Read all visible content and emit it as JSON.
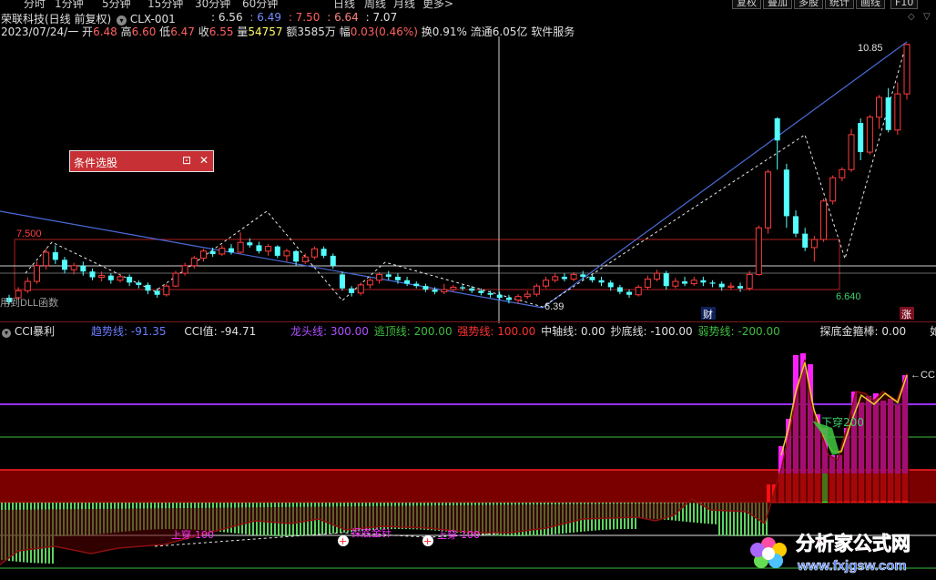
{
  "period_bar": {
    "items": [
      "分时",
      "1分钟",
      "5分钟",
      "15分钟",
      "30分钟",
      "60分钟",
      "日线",
      "周线",
      "月线",
      "更多>"
    ],
    "buttons": [
      "复权",
      "叠加",
      "多股",
      "统计",
      "画线",
      "F10"
    ]
  },
  "header": {
    "stock_name": "荣联科技(日线 前复权)",
    "indicator_name": "CLX-001",
    "ind_v1": ": 6.56",
    "ind_v2": ": 6.49",
    "ind_v3": ": 7.50",
    "ind_v4": ": 6.64",
    "ind_v5": ": 7.07",
    "date": "2023/07/24/一",
    "open_label": "开",
    "open": "6.48",
    "high_label": "高",
    "high": "6.60",
    "low_label": "低",
    "low": "6.47",
    "close_label": "收",
    "close": "6.55",
    "vol_label": "量",
    "vol": "54757",
    "amount": "额3585万",
    "change_label": "幅",
    "change": "0.03(0.46%)",
    "turnover": "换0.91%",
    "float": "流通6.05亿",
    "sector": "软件服务"
  },
  "main_chart": {
    "level_high": "7.500",
    "level_low": "6.640",
    "peak_label": "10.85",
    "trough_label": "6.39",
    "dll_text": "用到DLL函数",
    "cai_badge": "财",
    "zhang_badge": "涨"
  },
  "panel": {
    "title": "条件选股",
    "restore": "⊡",
    "close": "✕"
  },
  "sub_header": {
    "name": "CCI暴利",
    "trend_label": "趋势线: -91.35",
    "cci_label": "CCI值: -94.71",
    "dragon_label": "龙头线: 300.00",
    "escape_label": "逃顶线: 200.00",
    "strong_label": "强势线: 100.00",
    "mid_label": "中轴线: 0.00",
    "bottom_label": "抄底线: -100.00",
    "weak_label": "弱势线: -200.00",
    "golden_label": "探底金箍棒: 0.00",
    "more_label": "如"
  },
  "sub_chart": {
    "down_cross": "下穿200",
    "up_cross": "上穿-100",
    "jinzhen": "探底金针",
    "breakthrough": "上穿-100",
    "cc_label": "←CC"
  },
  "watermark": {
    "cn": "分析家公式网",
    "url": "www.fxjgsw.com"
  },
  "colors": {
    "up": "#ff3c3c",
    "down": "#54ffff",
    "ma_blue": "#4a6bd8",
    "purple": "#9b30ff",
    "green_line": "#3ebd3e",
    "red_band": "#8a0000",
    "magenta": "#ff20ff"
  },
  "candles": [
    [
      6.42,
      6.5,
      6.38,
      6.55,
      "d"
    ],
    [
      6.5,
      6.62,
      6.46,
      6.68,
      "u"
    ],
    [
      6.62,
      6.78,
      6.58,
      6.85,
      "u"
    ],
    [
      6.78,
      7.05,
      6.74,
      7.12,
      "u"
    ],
    [
      7.05,
      7.28,
      6.98,
      7.35,
      "u"
    ],
    [
      7.28,
      7.15,
      7.08,
      7.4,
      "d"
    ],
    [
      7.15,
      6.98,
      6.92,
      7.2,
      "d"
    ],
    [
      6.98,
      7.05,
      6.9,
      7.1,
      "u"
    ],
    [
      7.05,
      6.95,
      6.88,
      7.12,
      "d"
    ],
    [
      6.95,
      6.85,
      6.8,
      7.0,
      "d"
    ],
    [
      6.85,
      6.88,
      6.78,
      6.95,
      "u"
    ],
    [
      6.88,
      6.8,
      6.74,
      6.92,
      "d"
    ],
    [
      6.8,
      6.86,
      6.76,
      6.9,
      "u"
    ],
    [
      6.86,
      6.76,
      6.7,
      6.9,
      "d"
    ],
    [
      6.76,
      6.72,
      6.66,
      6.8,
      "d"
    ],
    [
      6.72,
      6.62,
      6.56,
      6.76,
      "d"
    ],
    [
      6.62,
      6.55,
      6.5,
      6.66,
      "d"
    ],
    [
      6.55,
      6.7,
      6.52,
      6.74,
      "u"
    ],
    [
      6.7,
      6.92,
      6.68,
      6.96,
      "u"
    ],
    [
      6.92,
      7.05,
      6.88,
      7.1,
      "u"
    ],
    [
      7.05,
      7.18,
      7.0,
      7.22,
      "u"
    ],
    [
      7.18,
      7.3,
      7.12,
      7.34,
      "u"
    ],
    [
      7.3,
      7.25,
      7.2,
      7.36,
      "d"
    ],
    [
      7.25,
      7.35,
      7.22,
      7.4,
      "u"
    ],
    [
      7.35,
      7.28,
      7.24,
      7.42,
      "d"
    ],
    [
      7.28,
      7.45,
      7.26,
      7.62,
      "u"
    ],
    [
      7.45,
      7.4,
      7.36,
      7.52,
      "d"
    ],
    [
      7.4,
      7.3,
      7.26,
      7.46,
      "d"
    ],
    [
      7.3,
      7.38,
      7.22,
      7.42,
      "u"
    ],
    [
      7.38,
      7.22,
      7.18,
      7.4,
      "d"
    ],
    [
      7.22,
      7.3,
      7.12,
      7.34,
      "u"
    ],
    [
      7.3,
      7.12,
      7.05,
      7.32,
      "d"
    ],
    [
      7.12,
      7.2,
      7.08,
      7.26,
      "u"
    ],
    [
      7.2,
      7.34,
      7.16,
      7.38,
      "u"
    ],
    [
      7.34,
      7.22,
      7.18,
      7.38,
      "d"
    ],
    [
      7.22,
      7.05,
      7.0,
      7.26,
      "d"
    ],
    [
      6.9,
      6.66,
      6.62,
      6.95,
      "d"
    ],
    [
      6.66,
      6.58,
      6.52,
      6.7,
      "d"
    ],
    [
      6.58,
      6.72,
      6.54,
      6.76,
      "u"
    ],
    [
      6.72,
      6.8,
      6.66,
      6.84,
      "u"
    ],
    [
      6.8,
      6.9,
      6.74,
      6.94,
      "u"
    ],
    [
      6.9,
      6.86,
      6.8,
      6.96,
      "d"
    ],
    [
      6.86,
      6.8,
      6.74,
      6.92,
      "d"
    ],
    [
      6.8,
      6.74,
      6.7,
      6.86,
      "d"
    ],
    [
      6.74,
      6.7,
      6.66,
      6.78,
      "d"
    ],
    [
      6.7,
      6.64,
      6.6,
      6.74,
      "d"
    ],
    [
      6.64,
      6.6,
      6.56,
      6.68,
      "d"
    ],
    [
      6.6,
      6.64,
      6.56,
      6.74,
      "u"
    ],
    [
      6.64,
      6.68,
      6.6,
      6.72,
      "u"
    ],
    [
      6.68,
      6.66,
      6.62,
      6.72,
      "d"
    ],
    [
      6.66,
      6.62,
      6.58,
      6.7,
      "d"
    ],
    [
      6.62,
      6.58,
      6.54,
      6.66,
      "d"
    ],
    [
      6.58,
      6.55,
      6.5,
      6.62,
      "d"
    ],
    [
      6.55,
      6.5,
      6.46,
      6.6,
      "d"
    ],
    [
      6.5,
      6.46,
      6.4,
      6.55,
      "d"
    ],
    [
      6.46,
      6.52,
      6.39,
      6.56,
      "u"
    ],
    [
      6.52,
      6.56,
      6.48,
      6.62,
      "u"
    ],
    [
      6.56,
      6.7,
      6.52,
      6.74,
      "u"
    ],
    [
      6.7,
      6.8,
      6.66,
      6.86,
      "u"
    ],
    [
      6.8,
      6.86,
      6.76,
      6.92,
      "u"
    ],
    [
      6.86,
      6.82,
      6.78,
      6.92,
      "d"
    ],
    [
      6.82,
      6.9,
      6.78,
      6.94,
      "u"
    ],
    [
      6.9,
      6.86,
      6.8,
      6.96,
      "d"
    ],
    [
      6.86,
      6.8,
      6.76,
      6.9,
      "d"
    ],
    [
      6.8,
      6.76,
      6.7,
      6.86,
      "d"
    ],
    [
      6.76,
      6.68,
      6.62,
      6.8,
      "d"
    ],
    [
      6.68,
      6.6,
      6.56,
      6.72,
      "d"
    ],
    [
      6.6,
      6.55,
      6.5,
      6.64,
      "d"
    ],
    [
      6.55,
      6.68,
      6.52,
      6.72,
      "u"
    ],
    [
      6.68,
      6.82,
      6.64,
      6.88,
      "u"
    ],
    [
      6.82,
      6.92,
      6.78,
      6.98,
      "u"
    ],
    [
      6.92,
      6.7,
      6.64,
      6.96,
      "d"
    ],
    [
      6.7,
      6.78,
      6.66,
      6.84,
      "u"
    ],
    [
      6.78,
      6.74,
      6.7,
      6.86,
      "d"
    ],
    [
      6.74,
      6.8,
      6.7,
      6.86,
      "u"
    ],
    [
      6.8,
      6.76,
      6.7,
      6.86,
      "d"
    ],
    [
      6.76,
      6.74,
      6.68,
      6.8,
      "d"
    ],
    [
      6.74,
      6.68,
      6.62,
      6.78,
      "d"
    ],
    [
      6.68,
      6.7,
      6.64,
      6.76,
      "u"
    ],
    [
      6.7,
      6.66,
      6.6,
      6.76,
      "d"
    ],
    [
      6.66,
      6.9,
      6.62,
      6.96,
      "u"
    ],
    [
      6.9,
      7.7,
      6.88,
      7.74,
      "u"
    ],
    [
      7.7,
      8.66,
      7.6,
      8.7,
      "u"
    ],
    [
      9.58,
      9.2,
      8.7,
      9.6,
      "d"
    ],
    [
      8.7,
      7.9,
      7.7,
      8.8,
      "d"
    ],
    [
      7.9,
      7.6,
      7.54,
      8.0,
      "d"
    ],
    [
      7.6,
      7.36,
      7.3,
      7.7,
      "d"
    ],
    [
      7.36,
      7.5,
      7.12,
      7.56,
      "u"
    ],
    [
      7.5,
      8.16,
      7.46,
      8.2,
      "u"
    ],
    [
      8.16,
      8.56,
      8.1,
      8.6,
      "u"
    ],
    [
      8.56,
      8.7,
      8.5,
      8.74,
      "u"
    ],
    [
      8.7,
      9.3,
      8.66,
      9.4,
      "u"
    ],
    [
      9.5,
      9.0,
      8.86,
      9.58,
      "d"
    ],
    [
      9.0,
      9.6,
      8.96,
      9.64,
      "u"
    ],
    [
      9.6,
      9.94,
      9.4,
      9.98,
      "u"
    ],
    [
      9.94,
      9.38,
      9.34,
      10.1,
      "d"
    ],
    [
      9.38,
      10.0,
      9.3,
      10.2,
      "u"
    ],
    [
      10.0,
      10.85,
      9.9,
      10.85,
      "u"
    ]
  ]
}
